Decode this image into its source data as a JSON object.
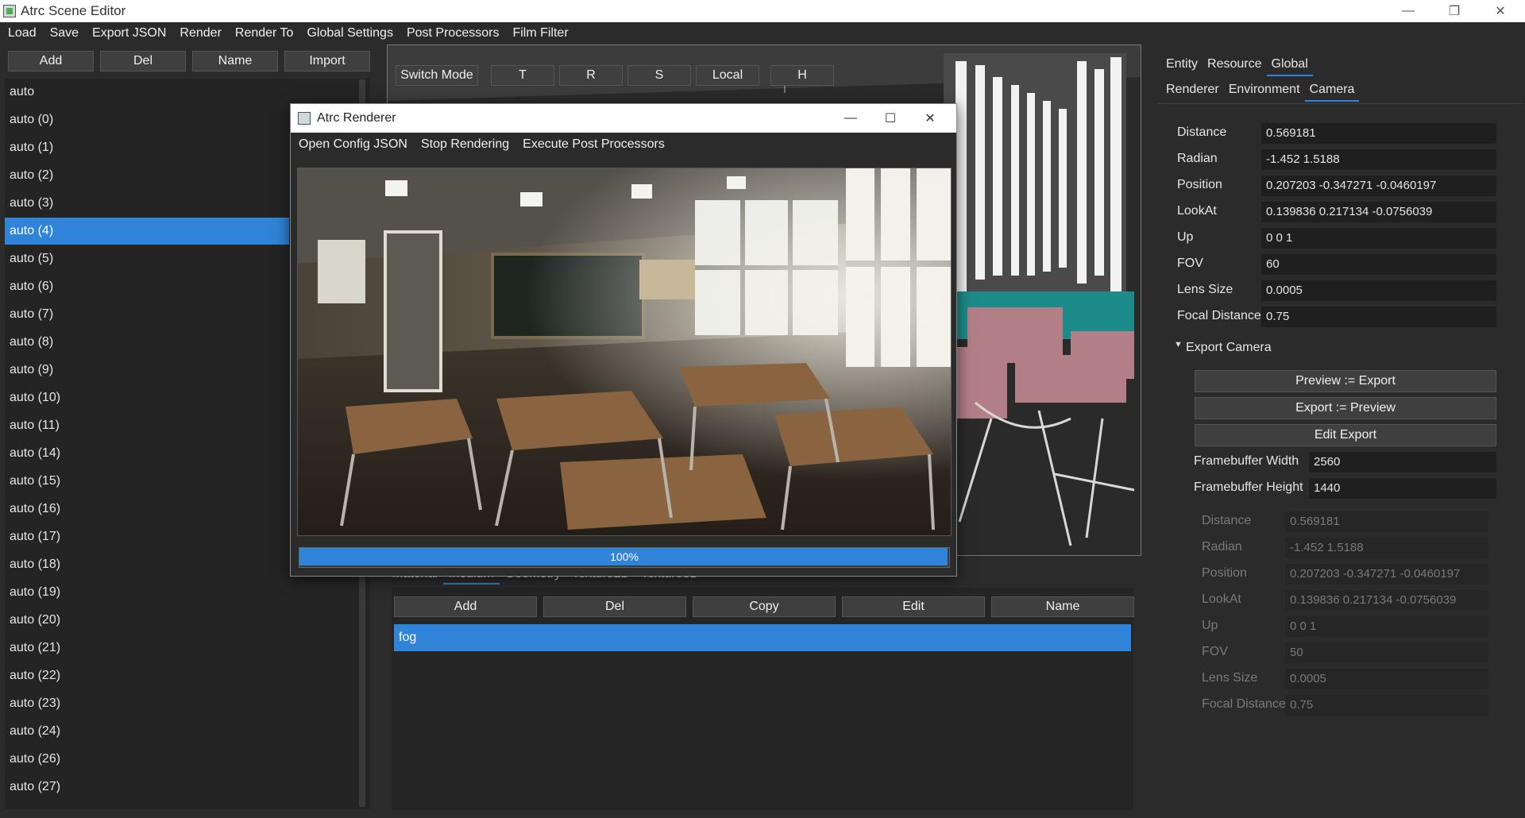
{
  "window": {
    "title": "Atrc Scene Editor"
  },
  "menubar": [
    "Load",
    "Save",
    "Export JSON",
    "Render",
    "Render To",
    "Global Settings",
    "Post Processors",
    "Film Filter"
  ],
  "left_panel": {
    "buttons": [
      "Add",
      "Del",
      "Name",
      "Import"
    ],
    "items": [
      "auto",
      "auto (0)",
      "auto (1)",
      "auto (2)",
      "auto (3)",
      "auto (4)",
      "auto (5)",
      "auto (6)",
      "auto (7)",
      "auto (8)",
      "auto (9)",
      "auto (10)",
      "auto (11)",
      "auto (14)",
      "auto (15)",
      "auto (16)",
      "auto (17)",
      "auto (18)",
      "auto (19)",
      "auto (20)",
      "auto (21)",
      "auto (22)",
      "auto (23)",
      "auto (24)",
      "auto (26)",
      "auto (27)"
    ],
    "selected": "auto (4)"
  },
  "viewport": {
    "buttons": [
      "Switch Mode",
      "T",
      "R",
      "S",
      "Local",
      "H"
    ]
  },
  "resource_panel": {
    "tabs": [
      "Material",
      "Medium",
      "Geometry",
      "Texture2D",
      "Texture3D"
    ],
    "active_tab": "Medium",
    "buttons": [
      "Add",
      "Del",
      "Copy",
      "Edit",
      "Name"
    ],
    "items": [
      "fog"
    ]
  },
  "right_panel": {
    "tabs": [
      "Entity",
      "Resource",
      "Global"
    ],
    "active_tab": "Global",
    "subtabs": [
      "Renderer",
      "Environment",
      "Camera"
    ],
    "active_subtab": "Camera",
    "camera": [
      {
        "label": "Distance",
        "value": "0.569181"
      },
      {
        "label": "Radian",
        "value": "-1.452 1.5188"
      },
      {
        "label": "Position",
        "value": "0.207203 -0.347271 -0.0460197"
      },
      {
        "label": "LookAt",
        "value": "0.139836 0.217134 -0.0756039"
      },
      {
        "label": "Up",
        "value": "0 0 1"
      },
      {
        "label": "FOV",
        "value": "60"
      },
      {
        "label": "Lens Size",
        "value": "0.0005"
      },
      {
        "label": "Focal Distance",
        "value": "0.75"
      }
    ],
    "export_section": {
      "title": "Export Camera",
      "buttons": [
        "Preview := Export",
        "Export := Preview",
        "Edit Export"
      ],
      "framebuffer": [
        {
          "label": "Framebuffer Width",
          "value": "2560"
        },
        {
          "label": "Framebuffer Height",
          "value": "1440"
        }
      ],
      "export_camera": [
        {
          "label": "Distance",
          "value": "0.569181"
        },
        {
          "label": "Radian",
          "value": "-1.452 1.5188"
        },
        {
          "label": "Position",
          "value": "0.207203 -0.347271 -0.0460197"
        },
        {
          "label": "LookAt",
          "value": "0.139836 0.217134 -0.0756039"
        },
        {
          "label": "Up",
          "value": "0 0 1"
        },
        {
          "label": "FOV",
          "value": "50"
        },
        {
          "label": "Lens Size",
          "value": "0.0005"
        },
        {
          "label": "Focal Distance",
          "value": "0.75"
        }
      ]
    }
  },
  "renderer_dialog": {
    "title": "Atrc Renderer",
    "menu": [
      "Open Config JSON",
      "Stop Rendering",
      "Execute Post Processors"
    ],
    "progress_percent": 100,
    "progress_text": "100%"
  },
  "colors": {
    "accent": "#2f83d8",
    "background": "#2b2b2b",
    "panel": "#242424"
  }
}
